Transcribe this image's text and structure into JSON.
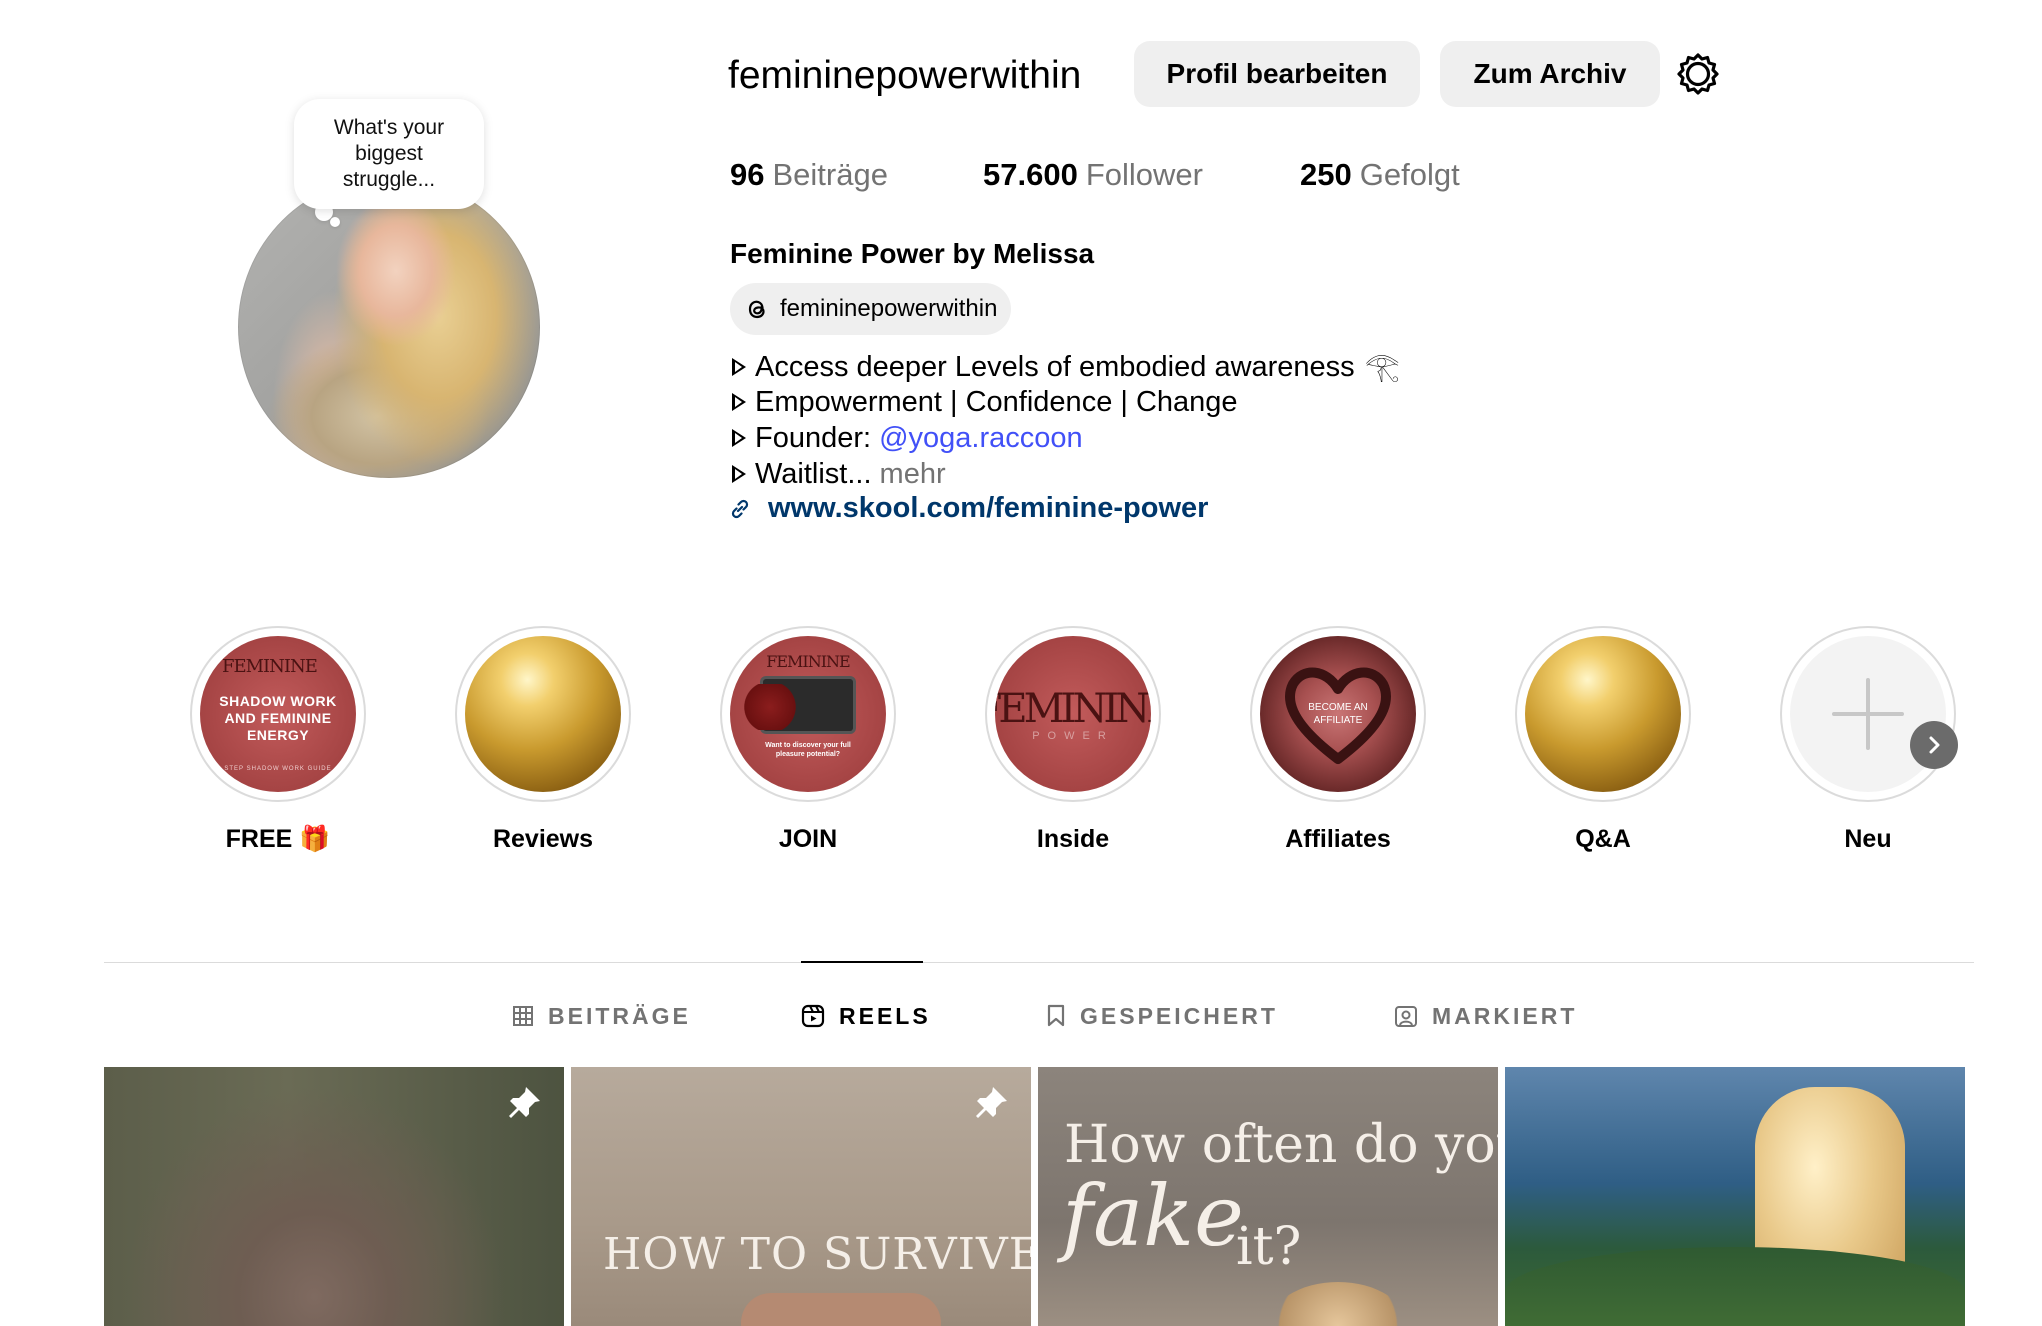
{
  "profile": {
    "username": "femininepowerwithin",
    "note": "What's your biggest struggle...",
    "edit_button": "Profil bearbeiten",
    "archive_button": "Zum Archiv",
    "settings_icon": "settings-gear-icon"
  },
  "stats": {
    "posts_count": "96",
    "posts_label": "Beiträge",
    "followers_count": "57.600",
    "followers_label": "Follower",
    "following_count": "250",
    "following_label": "Gefolgt"
  },
  "bio": {
    "full_name": "Feminine Power by Melissa",
    "threads_handle": "femininepowerwithin",
    "line1": "Access deeper Levels of embodied awareness",
    "line1_emoji": "𓂀",
    "line2": "Empowerment | Confidence | Change",
    "line3_prefix": "Founder:",
    "line3_mention": "@yoga.raccoon",
    "line4": "Waitlist...",
    "more": "mehr",
    "link": "www.skool.com/feminine-power"
  },
  "highlights": [
    {
      "label": "FREE 🎁",
      "cover_title": "FEMININE",
      "cover_text": "SHADOW WORK AND FEMININE ENERGY",
      "cover_sub": "STEP SHADOW WORK GUIDE"
    },
    {
      "label": "Reviews"
    },
    {
      "label": "JOIN",
      "cover_title": "FEMININE",
      "cover_sub": "Want to discover your full pleasure potential?"
    },
    {
      "label": "Inside",
      "cover_title": "FEMININE",
      "cover_sub": "POWER"
    },
    {
      "label": "Affiliates",
      "cover_text": "BECOME AN AFFILIATE"
    },
    {
      "label": "Q&A"
    },
    {
      "label": "Neu"
    }
  ],
  "tabs": [
    {
      "label": "BEITRÄGE",
      "icon": "grid-icon",
      "active": false
    },
    {
      "label": "REELS",
      "icon": "reels-icon",
      "active": true
    },
    {
      "label": "GESPEICHERT",
      "icon": "bookmark-icon",
      "active": false
    },
    {
      "label": "MARKIERT",
      "icon": "tagged-icon",
      "active": false
    }
  ],
  "reels": [
    {
      "pinned": true
    },
    {
      "pinned": true,
      "overlay_text": "HOW TO SURVIVE"
    },
    {
      "pinned": false,
      "overlay_line1": "How often do you",
      "overlay_line2": "fake",
      "overlay_line3": "it?"
    },
    {
      "pinned": false
    }
  ],
  "colors": {
    "link": "#00376b",
    "mention": "#4150f7",
    "muted": "#737373",
    "button_bg": "#efefef"
  }
}
